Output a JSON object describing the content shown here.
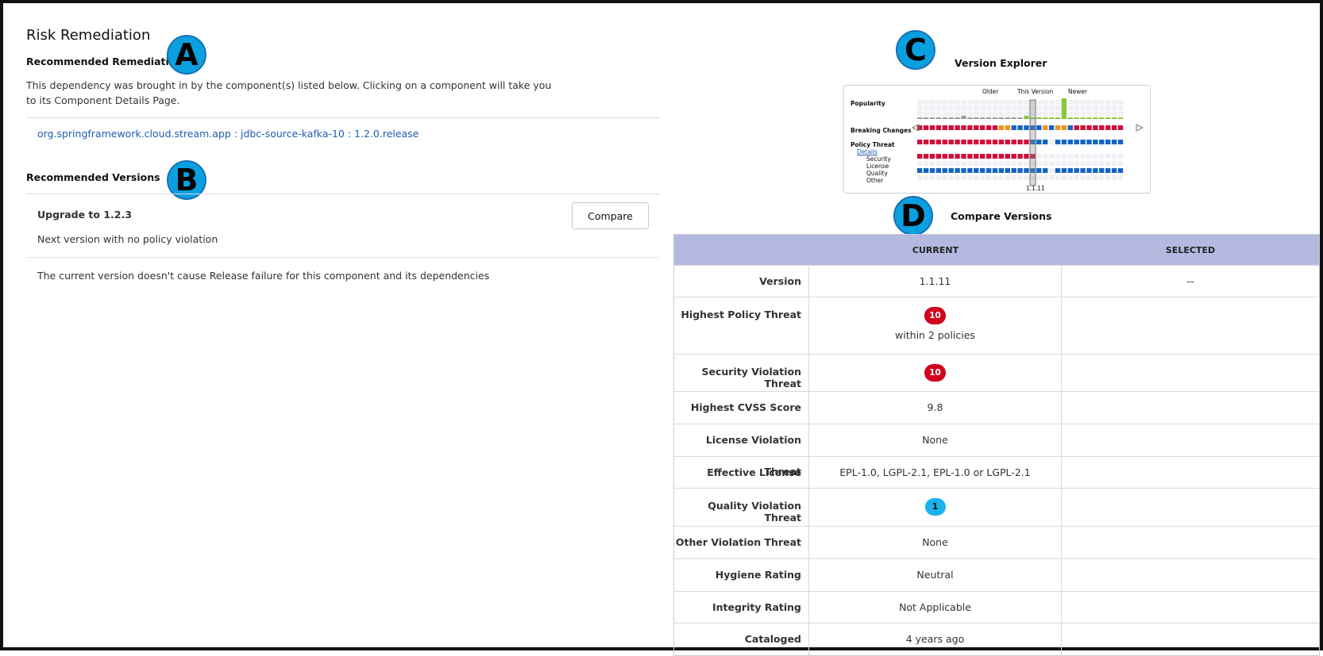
{
  "left": {
    "title": "Risk Remediation",
    "recommended_remediation": {
      "heading": "Recommended Remediation",
      "description_line1": "This dependency was brought in by the component(s) listed below. Clicking on a component will take you",
      "description_line2": "to its Component Details Page.",
      "component_link": "org.springframework.cloud.stream.app : jdbc-source-kafka-10 : 1.2.0.release"
    },
    "recommended_versions": {
      "heading": "Recommended Versions",
      "upgrade_label": "Upgrade to 1.2.3",
      "compare_button": "Compare",
      "next_version_note": "Next version with no policy violation",
      "release_note": "The current version doesn't cause Release failure for this component and its dependencies"
    }
  },
  "markers": {
    "a": "A",
    "b": "B",
    "c": "C",
    "d": "D"
  },
  "version_explorer": {
    "title": "Version Explorer",
    "older": "Older",
    "this_version": "This Version",
    "newer": "Newer",
    "rows": {
      "popularity": "Popularity",
      "breaking_changes": "Breaking Changes",
      "policy_threat": "Policy Threat",
      "details": "Details",
      "security": "Security",
      "license": "License",
      "quality": "Quality",
      "other": "Other"
    },
    "selected_version": "1.1.11"
  },
  "compare_versions": {
    "title": "Compare Versions",
    "columns": {
      "current": "CURRENT",
      "selected": "SELECTED"
    },
    "rows": [
      {
        "label": "Version",
        "current": "1.1.11",
        "selected": "--"
      },
      {
        "label": "Highest Policy Threat",
        "badge": "10",
        "badge_color": "#d0021b",
        "current_sub": "within 2 policies",
        "selected": ""
      },
      {
        "label": "Security Violation Threat",
        "badge": "10",
        "badge_color": "#d0021b",
        "selected": ""
      },
      {
        "label": "Highest CVSS Score",
        "current": "9.8",
        "selected": ""
      },
      {
        "label": "License Violation Threat",
        "current": "None",
        "selected": ""
      },
      {
        "label": "Effective License",
        "current": "EPL-1.0, LGPL-2.1, EPL-1.0 or LGPL-2.1",
        "selected": ""
      },
      {
        "label": "Quality Violation Threat",
        "badge": "1",
        "badge_color": "#19b2ec",
        "selected": ""
      },
      {
        "label": "Other Violation Threat",
        "current": "None",
        "selected": ""
      },
      {
        "label": "Hygiene Rating",
        "current": "Neutral",
        "selected": ""
      },
      {
        "label": "Integrity Rating",
        "current": "Not Applicable",
        "selected": ""
      },
      {
        "label": "Cataloged",
        "current": "4 years ago",
        "selected": ""
      }
    ]
  },
  "colors": {
    "link": "#1f5db3",
    "header_band": "#b4b9e0",
    "threat_red": "#d0021b",
    "quality_blue": "#19b2ec",
    "marker": "#0aa0e0",
    "breaking_red": "#d0103a",
    "breaking_orange": "#f0941f",
    "no_break_blue": "#1565c0",
    "popularity_green": "#8cc63f"
  }
}
